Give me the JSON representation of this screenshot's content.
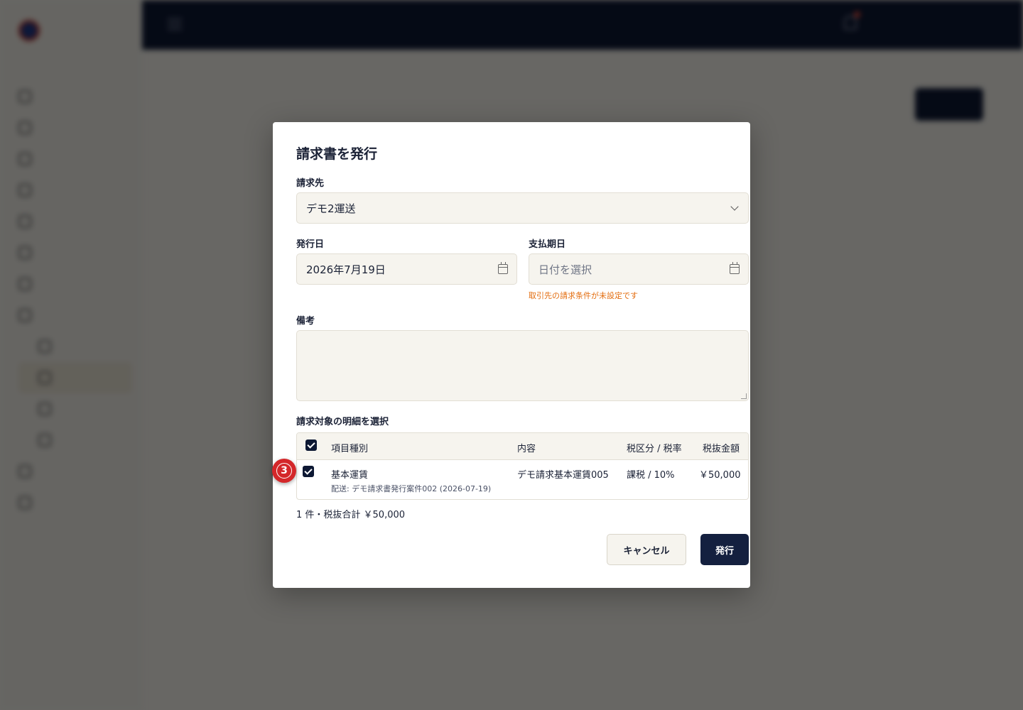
{
  "modal": {
    "title": "請求書を発行",
    "client": {
      "label": "請求先",
      "value": "デモ2運送"
    },
    "issue_date": {
      "label": "発行日",
      "value": "2026年7月19日"
    },
    "due_date": {
      "label": "支払期日",
      "placeholder": "日付を選択",
      "warning": "取引先の請求条件が未設定です"
    },
    "notes": {
      "label": "備考",
      "value": ""
    },
    "items_section": {
      "label": "請求対象の明細を選択",
      "headers": [
        "項目種別",
        "内容",
        "税区分 / 税率",
        "税抜金額"
      ],
      "rows": [
        {
          "checked": true,
          "item_type": "基本運賃",
          "detail": "配送: デモ請求書発行案件002 (2026-07-19)",
          "content": "デモ請求基本運賃005",
          "tax": "課税 / 10%",
          "amount": "￥50,000"
        }
      ],
      "summary": "1 件・税抜合計 ￥50,000"
    },
    "cancel_label": "キャンセル",
    "submit_label": "発行"
  },
  "step_badge": "③",
  "colors": {
    "primary": "#14203f",
    "warning": "#e36d0f",
    "badge": "#d4272a"
  }
}
